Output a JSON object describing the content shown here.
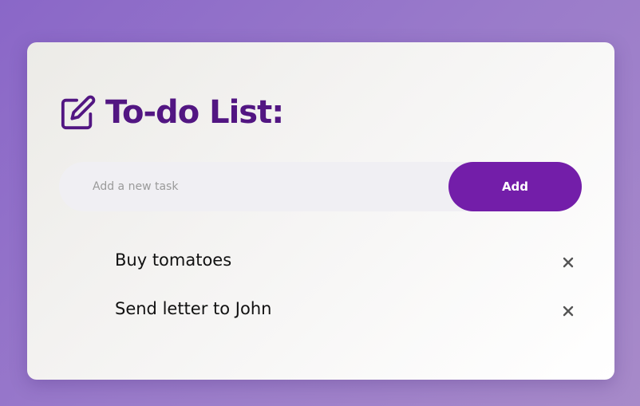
{
  "app": {
    "title": "To-do List:",
    "title_icon": "edit-icon"
  },
  "input": {
    "placeholder": "Add a new task",
    "value": ""
  },
  "add_button": {
    "label": "Add"
  },
  "tasks": [
    {
      "text": "Buy tomatoes",
      "delete_icon": "close-icon"
    },
    {
      "text": "Send letter to John",
      "delete_icon": "close-icon"
    }
  ],
  "colors": {
    "accent": "#731ea9",
    "title": "#521682",
    "background_start": "#8a67c8",
    "background_end": "#a78ac9"
  }
}
